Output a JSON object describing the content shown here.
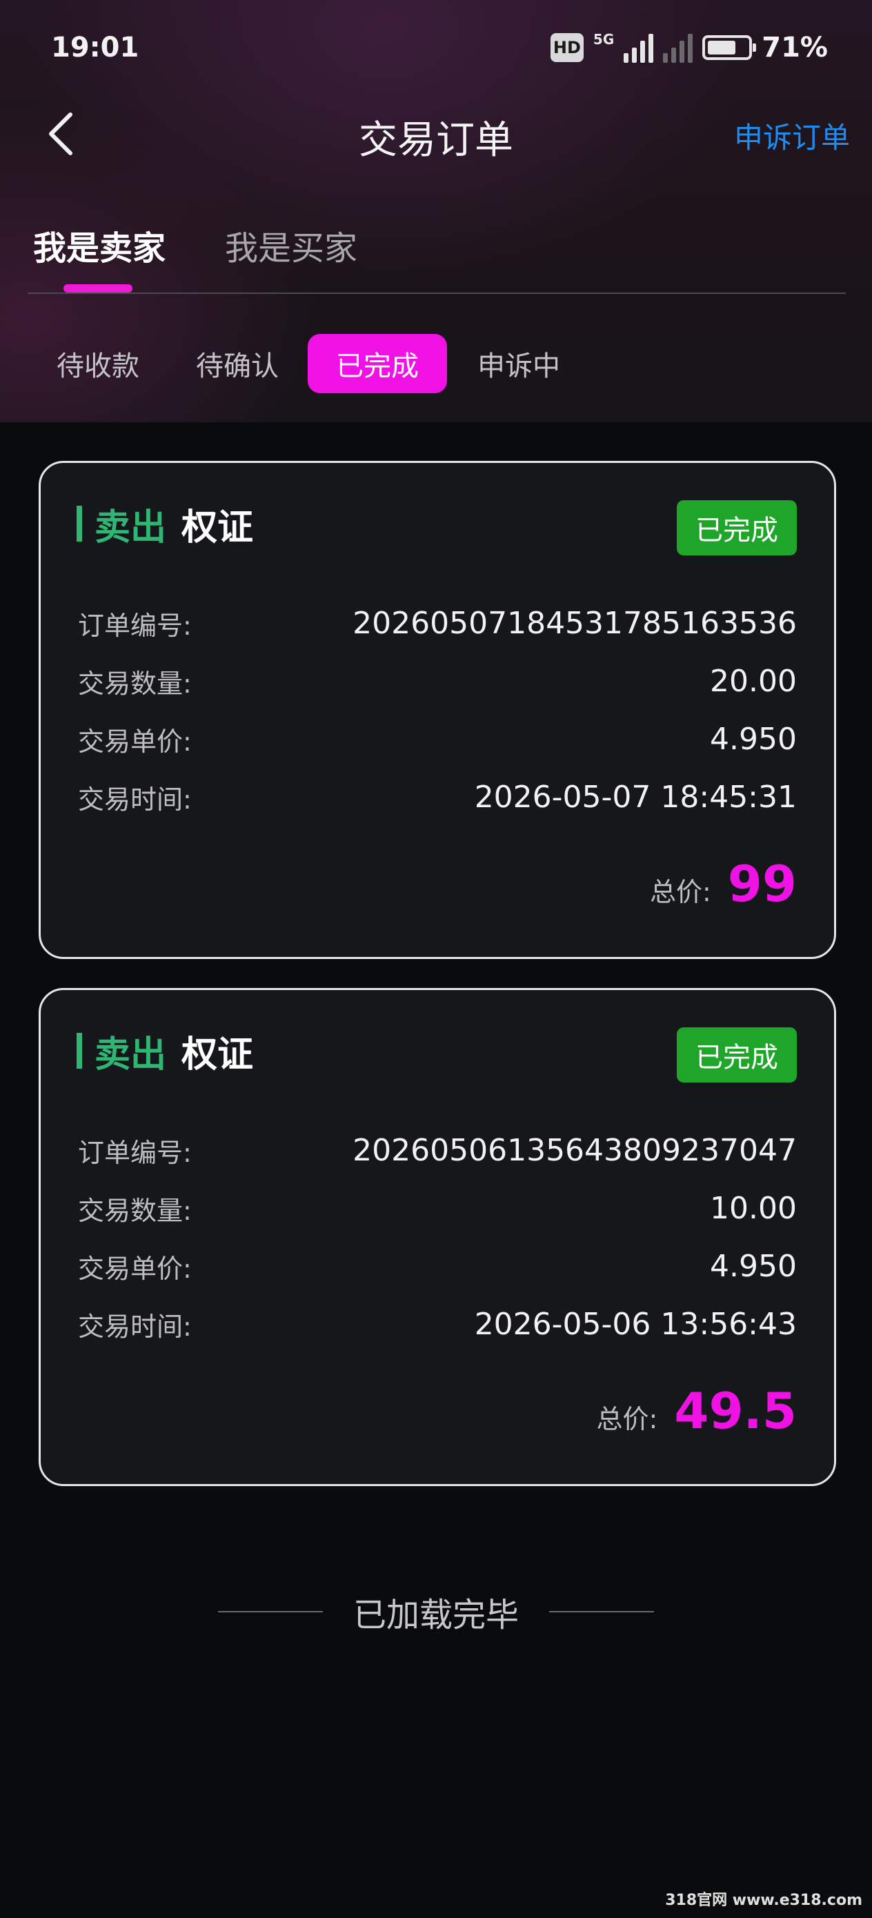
{
  "status_bar": {
    "time": "19:01",
    "hd_label": "HD",
    "hd_sub": "1",
    "network": "5G",
    "battery_percent": "71%",
    "battery_level": 0.71
  },
  "header": {
    "title": "交易订单",
    "appeal_link": "申诉订单",
    "back_icon": "chevron-left-icon"
  },
  "role_tabs": [
    {
      "label": "我是卖家",
      "active": true
    },
    {
      "label": "我是买家",
      "active": false
    }
  ],
  "status_tabs": [
    {
      "label": "待收款",
      "active": false
    },
    {
      "label": "待确认",
      "active": false
    },
    {
      "label": "已完成",
      "active": true
    },
    {
      "label": "申诉中",
      "active": false
    }
  ],
  "field_labels": {
    "order_no": "订单编号:",
    "quantity": "交易数量:",
    "unit_price": "交易单价:",
    "time": "交易时间:",
    "total": "总价:"
  },
  "orders": [
    {
      "side": "卖出",
      "asset": "权证",
      "status": "已完成",
      "order_no": "20260507184531785163536",
      "quantity": "20.00",
      "unit_price": "4.950",
      "time": "2026-05-07 18:45:31",
      "total": "99"
    },
    {
      "side": "卖出",
      "asset": "权证",
      "status": "已完成",
      "order_no": "20260506135643809237047",
      "quantity": "10.00",
      "unit_price": "4.950",
      "time": "2026-05-06 13:56:43",
      "total": "49.5"
    }
  ],
  "footer": {
    "end_text": "已加载完毕"
  },
  "watermark": "318官网 www.e318.com",
  "colors": {
    "accent_magenta": "#f012e4",
    "sell_green": "#2fb673",
    "done_badge": "#1fa62a",
    "link_blue": "#1f8cf0"
  }
}
